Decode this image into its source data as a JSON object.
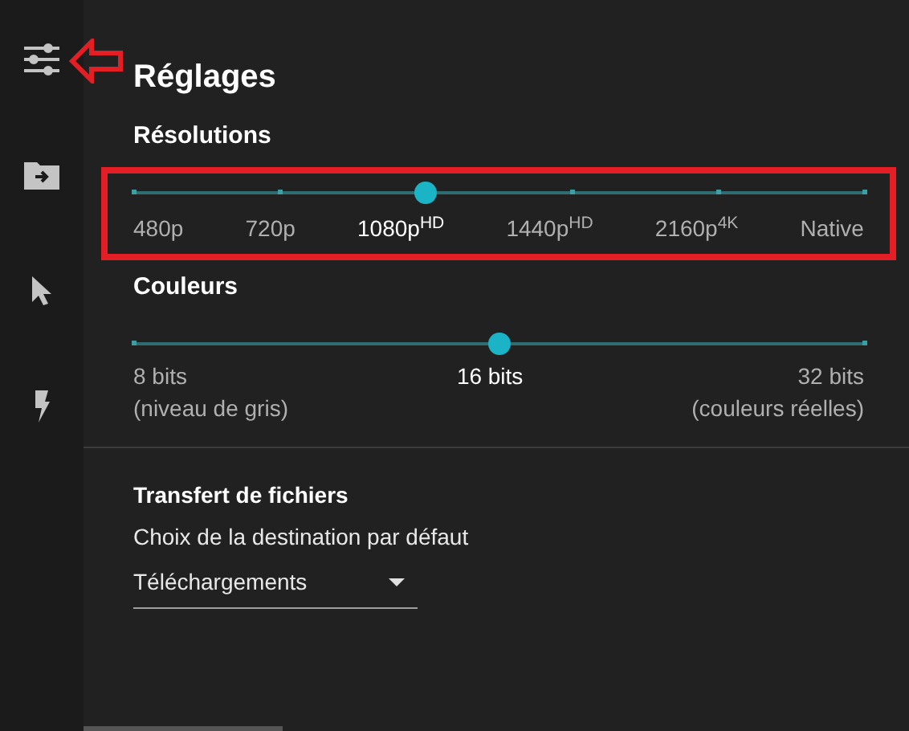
{
  "sidebar": {
    "items": [
      {
        "kind": "sliders"
      },
      {
        "kind": "folder"
      },
      {
        "kind": "pointer"
      },
      {
        "kind": "bolt"
      }
    ]
  },
  "title": "Réglages",
  "resolutions": {
    "heading": "Résolutions",
    "level": 0.4,
    "marks": [
      {
        "label": "480p",
        "selected": false
      },
      {
        "label": "720p",
        "selected": false
      },
      {
        "label": "1080p$^{HD}$",
        "selected": true
      },
      {
        "label": "1440p$^{HD}$",
        "selected": false
      },
      {
        "label": "2160p$^{4K}$",
        "selected": false
      },
      {
        "label": "Native",
        "selected": false
      }
    ]
  },
  "colors": {
    "heading": "Couleurs",
    "level": 0.5,
    "marks": [
      {
        "label": "8 bits",
        "sublabel": "(niveau de gris)",
        "selected": false
      },
      {
        "label": "16 bits",
        "selected": true
      },
      {
        "label": "32 bits",
        "sublabel": "(couleurs réelles)",
        "selected": false
      }
    ]
  },
  "transfer": {
    "heading": "Transfert de fichiers",
    "label": "Choix de la destination par défaut",
    "value": "Téléchargements"
  }
}
